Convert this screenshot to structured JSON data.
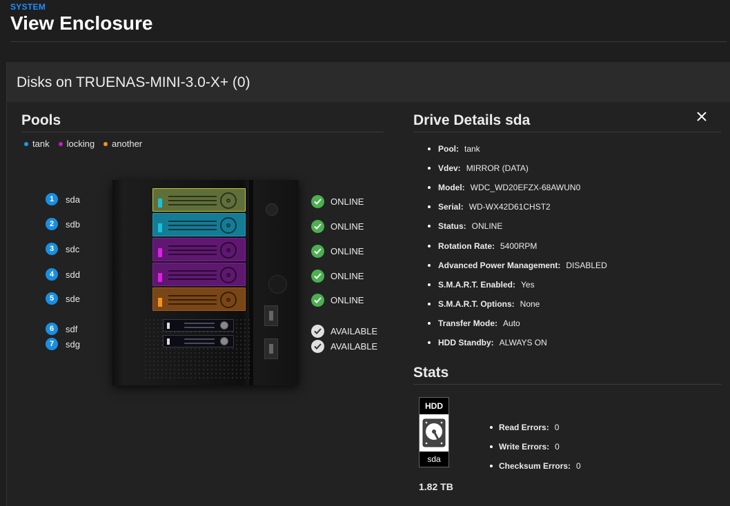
{
  "breadcrumb": "SYSTEM",
  "page_title": "View Enclosure",
  "card_title": "Disks on TRUENAS-MINI-3.0-X+ (0)",
  "pools": {
    "title": "Pools",
    "legend": [
      {
        "name": "tank",
        "color": "#1b9ce6"
      },
      {
        "name": "locking",
        "color": "#c41cc8"
      },
      {
        "name": "another",
        "color": "#f5921e"
      }
    ]
  },
  "disks": [
    {
      "slot": "1",
      "name": "sda",
      "status": "ONLINE",
      "pool_color": "#1b9ce6",
      "bay_color": "#5f6f3a",
      "led": "#17c2d8"
    },
    {
      "slot": "2",
      "name": "sdb",
      "status": "ONLINE",
      "pool_color": "#1b9ce6",
      "bay_color": "#157c96",
      "led": "#17c2d8"
    },
    {
      "slot": "3",
      "name": "sdc",
      "status": "ONLINE",
      "pool_color": "#c41cc8",
      "bay_color": "#5f1870",
      "led": "#e01ee6"
    },
    {
      "slot": "4",
      "name": "sdd",
      "status": "ONLINE",
      "pool_color": "#c41cc8",
      "bay_color": "#5f1870",
      "led": "#e01ee6"
    },
    {
      "slot": "5",
      "name": "sde",
      "status": "ONLINE",
      "pool_color": "#f5921e",
      "bay_color": "#7a4616",
      "led": "#f5921e"
    },
    {
      "slot": "6",
      "name": "sdf",
      "status": "AVAILABLE",
      "pool_color": "#888888"
    },
    {
      "slot": "7",
      "name": "sdg",
      "status": "AVAILABLE",
      "pool_color": "#888888"
    }
  ],
  "colors": {
    "online": "#4caf50",
    "available": "#e0e0e0",
    "accent": "#1a8fe0"
  },
  "drive_details": {
    "title": "Drive Details sda",
    "items": [
      {
        "key": "Pool:",
        "value": "tank"
      },
      {
        "key": "Vdev:",
        "value": "MIRROR (DATA)"
      },
      {
        "key": "Model:",
        "value": "WDC_WD20EFZX-68AWUN0"
      },
      {
        "key": "Serial:",
        "value": "WD-WX42D61CHST2"
      },
      {
        "key": "Status:",
        "value": "ONLINE"
      },
      {
        "key": "Rotation Rate:",
        "value": "5400RPM"
      },
      {
        "key": "Advanced Power Management:",
        "value": "DISABLED"
      },
      {
        "key": "S.M.A.R.T. Enabled:",
        "value": "Yes"
      },
      {
        "key": "S.M.A.R.T. Options:",
        "value": "None"
      },
      {
        "key": "Transfer Mode:",
        "value": "Auto"
      },
      {
        "key": "HDD Standby:",
        "value": "ALWAYS ON"
      }
    ]
  },
  "stats": {
    "title": "Stats",
    "hdd_type": "HDD",
    "disk_name": "sda",
    "capacity": "1.82 TB",
    "items": [
      {
        "key": "Read Errors:",
        "value": "0"
      },
      {
        "key": "Write Errors:",
        "value": "0"
      },
      {
        "key": "Checksum Errors:",
        "value": "0"
      }
    ]
  },
  "icons": {
    "close": "close-icon",
    "check": "check-circle-icon",
    "hdd": "hard-drive-icon"
  }
}
